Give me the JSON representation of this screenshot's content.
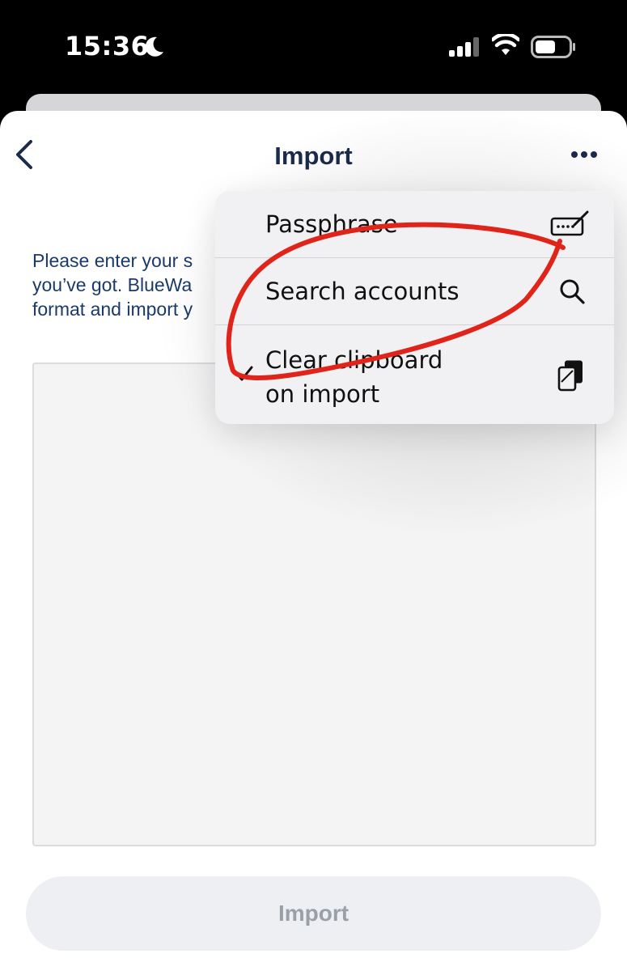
{
  "status_bar": {
    "time": "15:36",
    "icons": [
      "moon-icon",
      "signal-icon",
      "wifi-icon",
      "battery-icon"
    ]
  },
  "nav": {
    "title": "Import",
    "back_icon": "chevron-left-icon",
    "more_icon": "ellipsis-icon"
  },
  "instructions": "Please enter your s\nyou’ve got. BlueWa\nformat and import y",
  "text_area": {
    "value": ""
  },
  "import_button": {
    "label": "Import"
  },
  "menu": {
    "items": [
      {
        "label": "Passphrase",
        "icon": "keyboard-pencil-icon",
        "checked": false
      },
      {
        "label": "Search accounts",
        "icon": "search-icon",
        "checked": false
      },
      {
        "label": "Clear clipboard\non import",
        "icon": "clipboard-icon",
        "checked": true
      }
    ]
  },
  "colors": {
    "title": "#1a2b4b",
    "instructions": "#1a3a6a",
    "annotation": "#e0241a",
    "import_button_bg": "#eeeff2",
    "import_button_text": "#9aa0a8"
  }
}
